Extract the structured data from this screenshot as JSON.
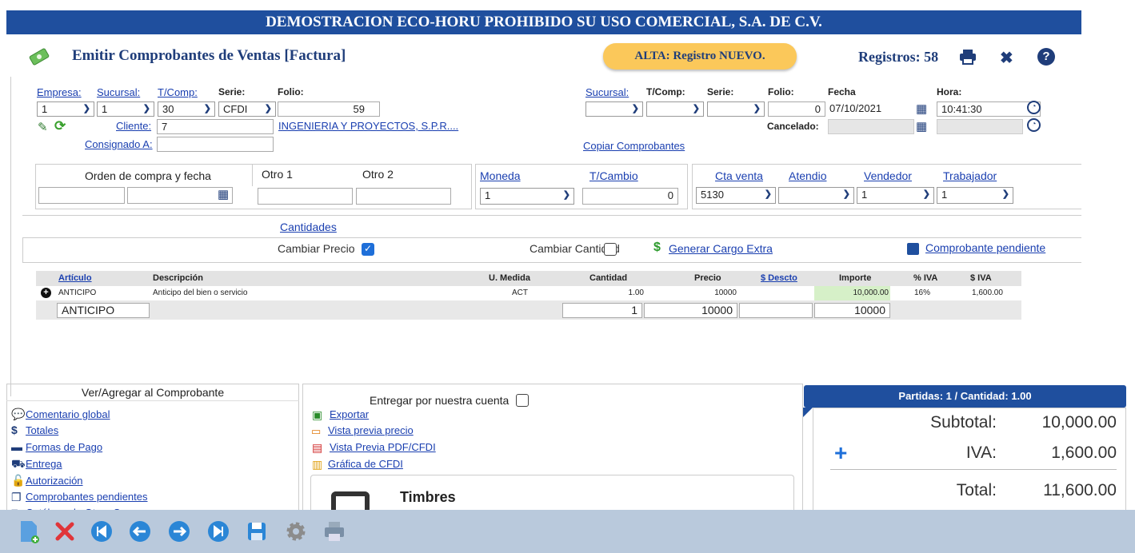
{
  "title_bar": "DEMOSTRACION ECO-HORU PROHIBIDO SU USO COMERCIAL, S.A. DE C.V.",
  "header": {
    "title": "Emitir Comprobantes de Ventas [Factura]",
    "status_pill": "ALTA: Registro NUEVO.",
    "records": "Registros: 58"
  },
  "form_left": {
    "empresa_label": "Empresa:",
    "sucursal_label": "Sucursal:",
    "tcomp_label": "T/Comp:",
    "serie_label": "Serie:",
    "folio_label": "Folio:",
    "empresa": "1",
    "sucursal": "1",
    "tcomp": "30",
    "serie": "CFDI",
    "folio": "59",
    "cliente_label": "Cliente:",
    "cliente": "7",
    "cliente_name": "INGENIERIA Y PROYECTOS, S.P.R....",
    "consignado_label": "Consignado A:"
  },
  "form_right": {
    "sucursal_label": "Sucursal:",
    "tcomp_label": "T/Comp:",
    "serie_label": "Serie:",
    "folio_label": "Folio:",
    "fecha_label": "Fecha",
    "hora_label": "Hora:",
    "folio": "0",
    "fecha": "07/10/2021",
    "hora": "10:41:30",
    "cancelado_label": "Cancelado:",
    "copiar": "Copiar Comprobantes"
  },
  "section2": {
    "orden_label": "Orden de compra y fecha",
    "otro1_label": "Otro 1",
    "otro2_label": "Otro 2",
    "moneda_label": "Moneda",
    "tcambio_label": "T/Cambio",
    "moneda": "1",
    "tcambio": "0",
    "cta_venta_label": "Cta venta",
    "atendio_label": "Atendio",
    "vendedor_label": "Vendedor",
    "trabajador_label": "Trabajador",
    "cta_venta": "5130",
    "vendedor": "1",
    "trabajador": "1"
  },
  "options": {
    "cantidades": "Cantidades",
    "cambiar_precio": "Cambiar Precio",
    "cambiar_cantidad": "Cambiar Cantidad",
    "generar_cargo": "Generar Cargo Extra",
    "pendiente": "Comprobante pendiente"
  },
  "table": {
    "headers": [
      "Artículo",
      "Descripción",
      "U. Medida",
      "Cantidad",
      "Precio",
      "$ Descto",
      "Importe",
      "% IVA",
      "$ IVA"
    ],
    "row": {
      "articulo": "ANTICIPO",
      "descripcion": "Anticipo del bien o servicio",
      "umedida": "ACT",
      "cantidad": "1.00",
      "precio": "10000",
      "importe": "10,000.00",
      "piva": "16%",
      "iva": "1,600.00"
    },
    "edit": {
      "articulo": "ANTICIPO",
      "cantidad": "1",
      "precio": "10000",
      "importe": "10000"
    }
  },
  "bottom_left": {
    "title": "Ver/Agregar al Comprobante",
    "links": [
      "Comentario global",
      "Totales",
      "Formas de Pago",
      "Entrega",
      "Autorización",
      "Comprobantes pendientes",
      "Catálogo de Otros Cargos"
    ]
  },
  "bottom_mid": {
    "entregar": "Entregar por nuestra cuenta",
    "links": [
      "Exportar",
      "Vista previa precio",
      "Vista Previa PDF/CFDI",
      "Gráfica de CFDI"
    ],
    "timbres": "Timbres"
  },
  "totals": {
    "partidas": "Partidas: 1 / Cantidad: 1.00",
    "subtotal_label": "Subtotal:",
    "subtotal": "10,000.00",
    "iva_label": "IVA:",
    "iva": "1,600.00",
    "total_label": "Total:",
    "total": "11,600.00"
  },
  "colors": {
    "title_bg": "#1f4f9e",
    "accent": "#1a3fb0",
    "pill": "#fbc85a",
    "toolbar_bg": "#b9c9dc"
  }
}
